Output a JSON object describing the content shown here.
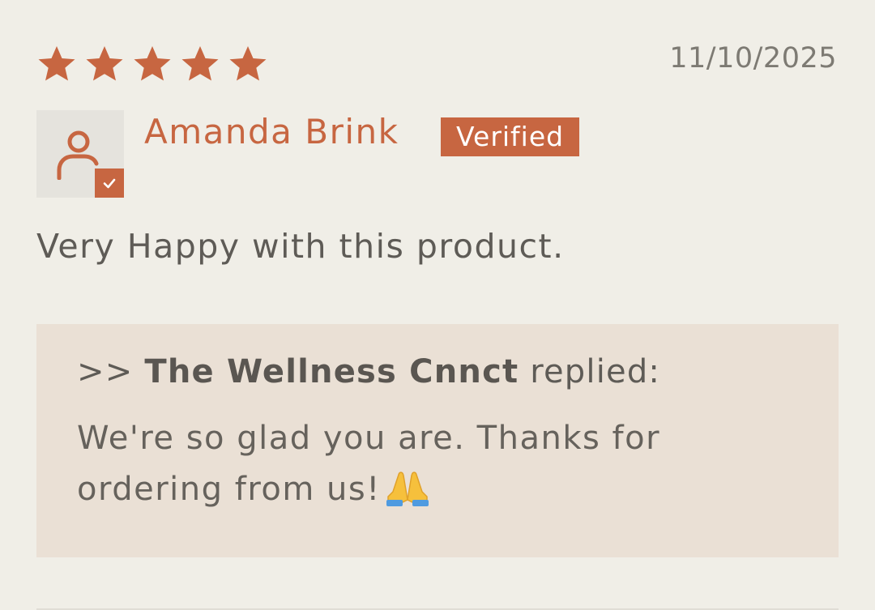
{
  "review": {
    "rating": 5,
    "rating_max": 5,
    "date": "11/10/2025",
    "author": "Amanda Brink",
    "badge": "Verified",
    "text": "Very Happy with this product.",
    "icons": {
      "avatar": "user-avatar-icon",
      "verified_check": "checkmark-icon",
      "star": "star-icon",
      "reply_emoji": "folded-hands-icon"
    }
  },
  "reply": {
    "prefix": ">>",
    "store_name": "The Wellness Cnnct",
    "suffix": "replied:",
    "text": "We're so glad you are. Thanks for ordering from us!"
  },
  "colors": {
    "accent": "#c76641",
    "background": "#f0eee7",
    "reply_background": "#eae0d5",
    "text": "#5e5b56"
  }
}
